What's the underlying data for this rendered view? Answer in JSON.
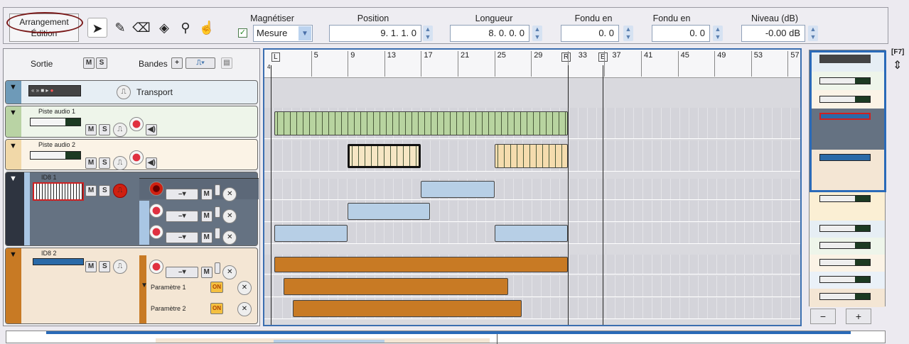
{
  "toolbar": {
    "mode_arrangement": "Arrangement",
    "mode_edition": "Édition",
    "tools": [
      "arrow-icon",
      "pencil-icon",
      "eraser-icon",
      "split-icon",
      "zoom-icon",
      "hand-icon"
    ],
    "magnetize_label": "Magnétiser",
    "magnetize_checked": true,
    "magnetize_value": "Mesure",
    "position_label": "Position",
    "position_value": "9. 1. 1.  0",
    "length_label": "Longueur",
    "length_value": "8. 0. 0.  0",
    "fade_in_label": "Fondu en",
    "fade_in_value": "0.  0",
    "fade_out_label": "Fondu en",
    "fade_out_value": "0.  0",
    "level_label": "Niveau (dB)",
    "level_value": "-0.00 dB"
  },
  "tracklist": {
    "output_label": "Sortie",
    "mute": "M",
    "solo": "S",
    "bands_label": "Bandes",
    "add": "+",
    "transport_label": "Transport",
    "tracks": [
      {
        "name": "Piste audio 1",
        "color": "#b9d3a4"
      },
      {
        "name": "Piste audio 2",
        "color": "#f1d8a8"
      },
      {
        "name": "ID8 1",
        "color": "#3a4250"
      },
      {
        "name": "ID8 2",
        "color": "#c87a24"
      }
    ],
    "params": [
      {
        "name": "Paramètre 1",
        "toggle": "ON"
      },
      {
        "name": "Paramètre 2",
        "toggle": "ON"
      }
    ]
  },
  "ruler": {
    "bars": [
      "5",
      "9",
      "13",
      "17",
      "21",
      "25",
      "29",
      "33",
      "37",
      "41",
      "45",
      "49",
      "53",
      "57"
    ],
    "loop_start": "L",
    "loop_end": "R",
    "end_marker": "E",
    "loop_start_sub": "4"
  },
  "clips": [
    {
      "lane": "audio1",
      "start": 1,
      "end": 33,
      "color": "#b8d4a0"
    },
    {
      "lane": "audio2",
      "start": 9,
      "end": 17,
      "color": "#f6e6c4",
      "selected": true
    },
    {
      "lane": "audio2",
      "start": 25,
      "end": 33,
      "color": "#f5dcae"
    },
    {
      "lane": "id8a",
      "start": 17,
      "end": 25,
      "color": "#b7cfe6"
    },
    {
      "lane": "id8b",
      "start": 9,
      "end": 18,
      "color": "#b7cfe6"
    },
    {
      "lane": "id8c",
      "start": 1,
      "end": 9,
      "color": "#b7cfe6"
    },
    {
      "lane": "id8c",
      "start": 25,
      "end": 33,
      "color": "#b7cfe6"
    },
    {
      "lane": "id82",
      "start": 1,
      "end": 33,
      "color": "#c87a24"
    },
    {
      "lane": "param1",
      "start": 2,
      "end": 26.5,
      "color": "#c87a24"
    },
    {
      "lane": "param2",
      "start": 3,
      "end": 28,
      "color": "#c87a24"
    }
  ],
  "minimap": {
    "shortcut": "[F7]",
    "zoom_out": "−",
    "zoom_in": "+"
  }
}
